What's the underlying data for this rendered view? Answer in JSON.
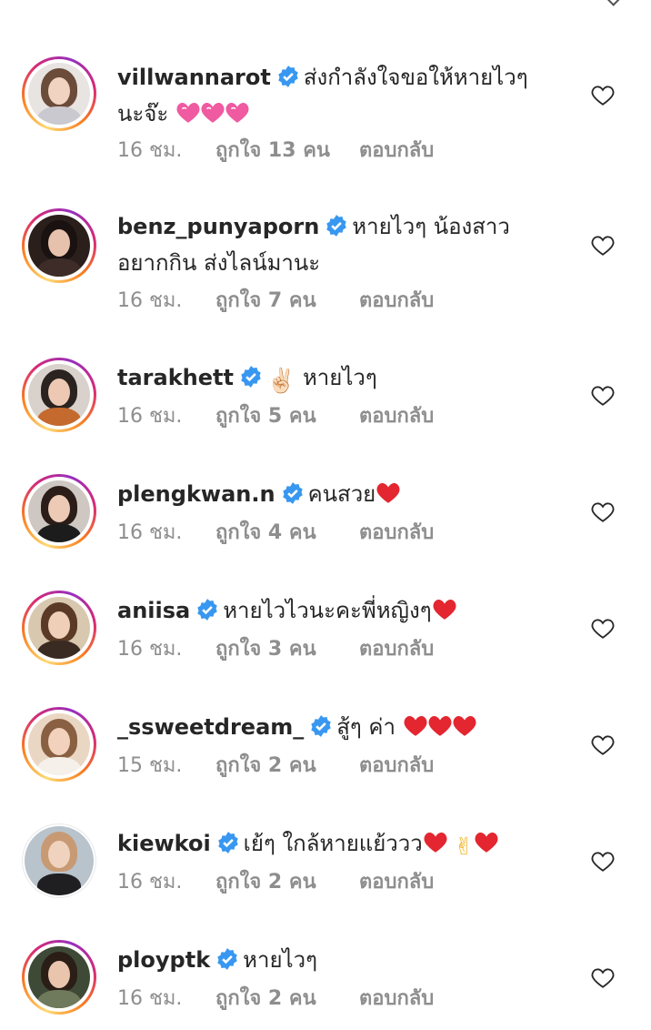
{
  "colors": {
    "username": "#262626",
    "meta": "#8e8e8e",
    "verified": "#3897f0",
    "emoji_red": "#e3262f",
    "emoji_pink": "#ef5aa1"
  },
  "comments": [
    {
      "username": "villwannarot",
      "verified": true,
      "text": "ส่งกำลังใจขอให้หายไวๆ",
      "text2": "นะจ๊ะ",
      "emoji": "pink-hearts",
      "time": "16 ชม.",
      "likes": "ถูกใจ 13 คน",
      "reply": "ตอบกลับ",
      "icon": "heart-outline-icon"
    },
    {
      "username": "benz_punyaporn",
      "verified": true,
      "text": "หายไวๆ น้องสาว",
      "text2": "อยากกิน ส่งไลน์มานะ",
      "time": "16 ชม.",
      "likes": "ถูกใจ 7 คน",
      "reply": "ตอบกลับ",
      "icon": "heart-outline-icon"
    },
    {
      "username": "tarakhett",
      "verified": true,
      "text": "หายไวๆ",
      "prefix_emoji": "✌🏻",
      "time": "16 ชม.",
      "likes": "ถูกใจ 5 คน",
      "reply": "ตอบกลับ",
      "icon": "heart-outline-icon"
    },
    {
      "username": "plengkwan.n",
      "verified": true,
      "text": "คนสวย",
      "emoji": "red-heart",
      "time": "16 ชม.",
      "likes": "ถูกใจ 4 คน",
      "reply": "ตอบกลับ",
      "icon": "heart-outline-icon"
    },
    {
      "username": "aniisa",
      "verified": true,
      "text": "หายไวไวนะคะพี่หญิงๆ",
      "emoji": "red-heart",
      "time": "16 ชม.",
      "likes": "ถูกใจ 3 คน",
      "reply": "ตอบกลับ",
      "icon": "heart-outline-icon"
    },
    {
      "username": "_ssweetdream_",
      "verified": true,
      "text": "สู้ๆ ค่า",
      "emoji": "three-red-hearts",
      "time": "15 ชม.",
      "likes": "ถูกใจ 2 คน",
      "reply": "ตอบกลับ",
      "icon": "heart-outline-icon"
    },
    {
      "username": "kiewkoi",
      "verified": true,
      "text": "เย้ๆ ใกล้หายแย้ววว",
      "emoji": "heart-victory-heart",
      "time": "16 ชม.",
      "likes": "ถูกใจ 2 คน",
      "reply": "ตอบกลับ",
      "icon": "heart-outline-icon"
    },
    {
      "username": "ploypt k",
      "verified": true,
      "text": "หายไวๆ",
      "time": "16 ชม.",
      "likes": "ถูกใจ 2 คน",
      "reply": "ตอบกลับ",
      "icon": "heart-outline-icon"
    }
  ]
}
